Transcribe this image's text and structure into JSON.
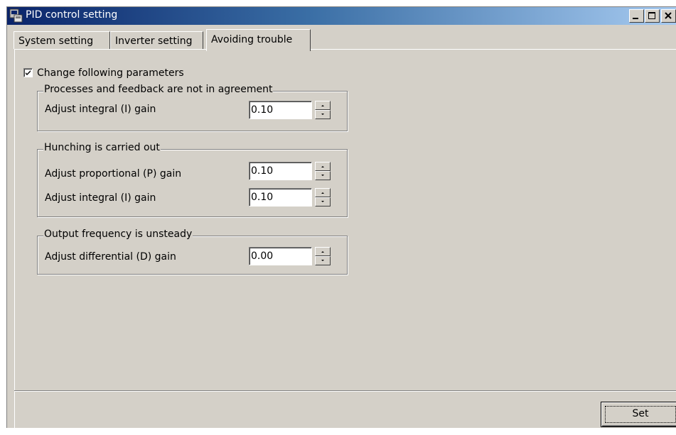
{
  "window": {
    "title": "PID control setting",
    "icon": "app-icon",
    "controls": [
      "minimize-icon",
      "maximize-icon",
      "close-icon"
    ]
  },
  "tabs": [
    {
      "label": "System setting",
      "active": false
    },
    {
      "label": "Inverter setting",
      "active": false
    },
    {
      "label": "Avoiding trouble",
      "active": true
    }
  ],
  "change_params": {
    "label": "Change following parameters",
    "checked": true
  },
  "groups": [
    {
      "title": "Processes and feedback are not in agreement",
      "rows": [
        {
          "label": "Adjust integral (I) gain",
          "value": "0.10"
        }
      ]
    },
    {
      "title": "Hunching is carried out",
      "rows": [
        {
          "label": "Adjust proportional (P) gain",
          "value": "0.10"
        },
        {
          "label": "Adjust integral (I) gain",
          "value": "0.10"
        }
      ]
    },
    {
      "title": "Output frequency is unsteady",
      "rows": [
        {
          "label": "Adjust differential (D) gain",
          "value": "0.00"
        }
      ]
    }
  ],
  "footer": {
    "set_label": "Set"
  },
  "colors": {
    "face": "#d4d0c8",
    "title_start": "#0a246a",
    "title_end": "#a6caf0"
  }
}
